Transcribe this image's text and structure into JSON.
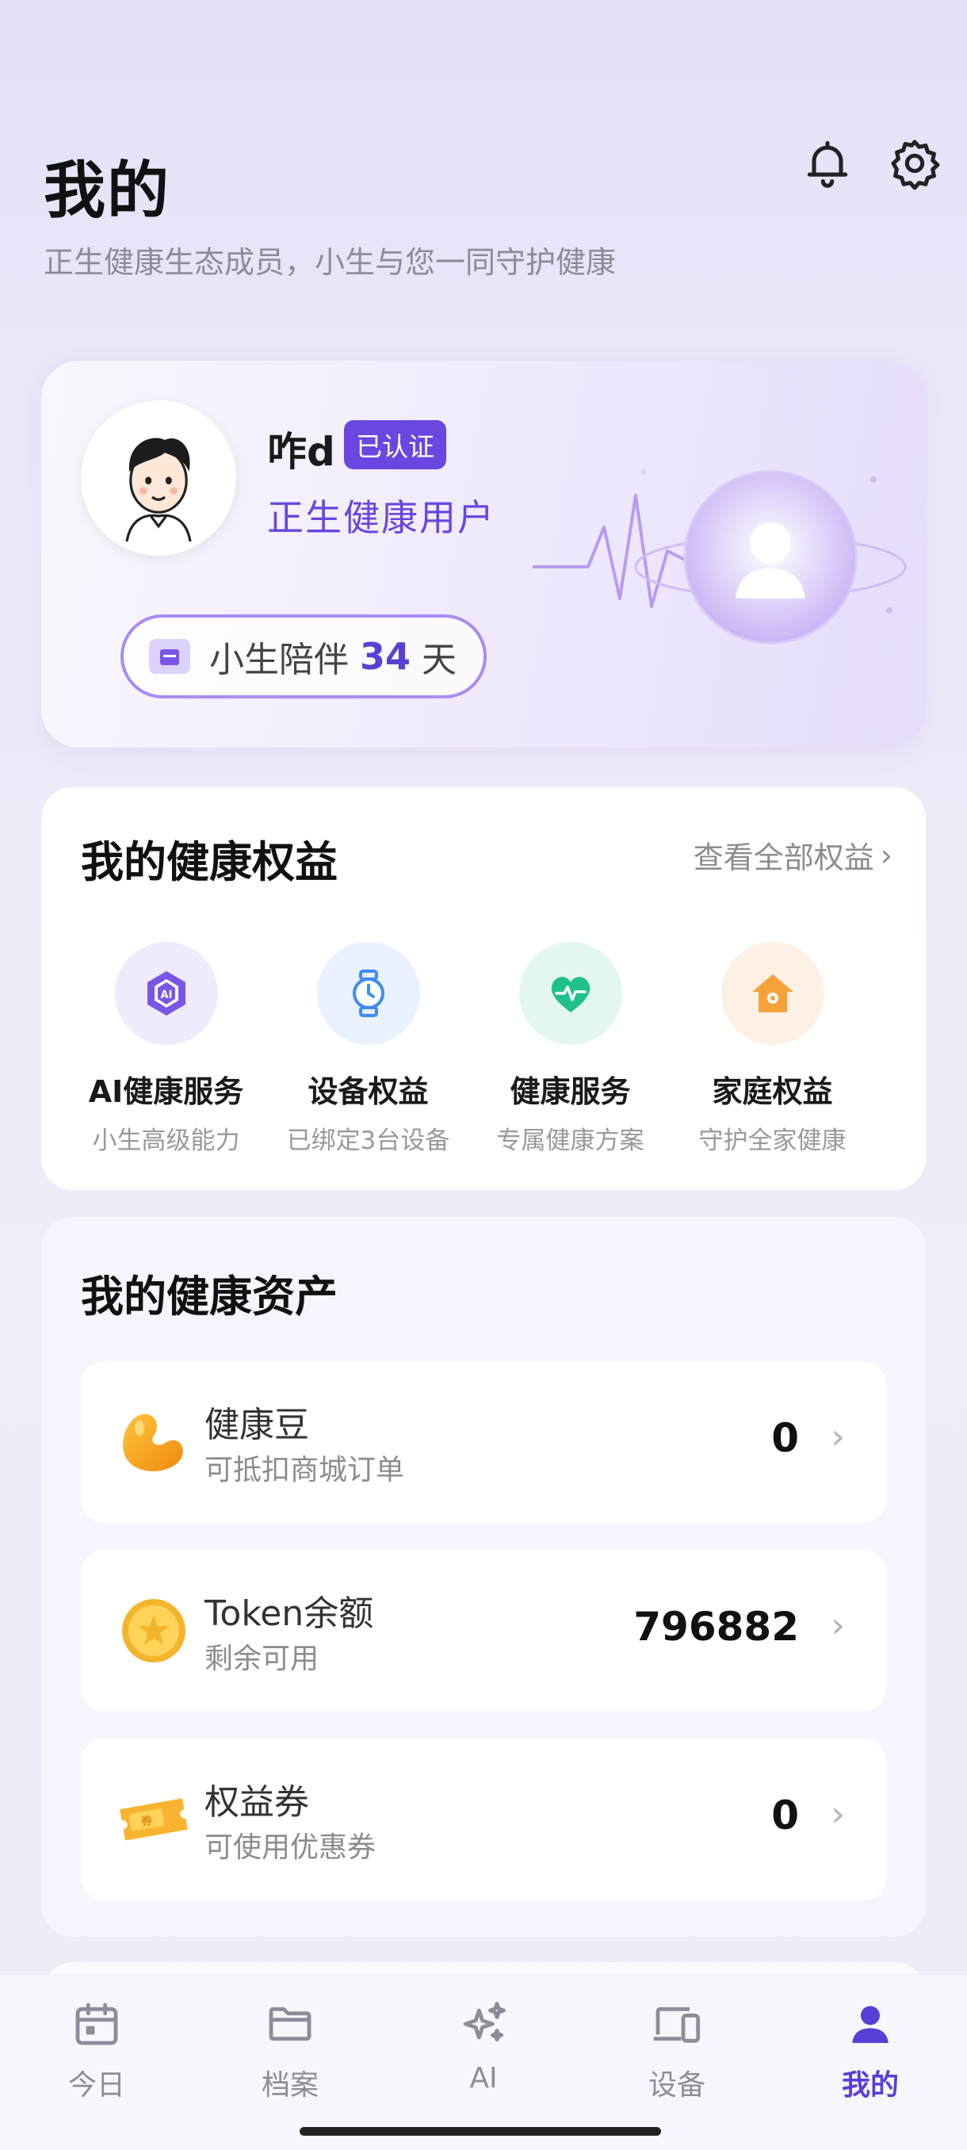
{
  "header": {
    "title": "我的",
    "subtitle": "正生健康生态成员，小生与您一同守护健康",
    "icons": [
      "bell-icon",
      "gear-icon"
    ]
  },
  "profile": {
    "name": "咋d",
    "badge": "已认证",
    "user_type": "正生健康用户",
    "companion_prefix": "小生陪伴",
    "companion_days": "34",
    "companion_unit": "天"
  },
  "benefits": {
    "title": "我的健康权益",
    "view_all": "查看全部权益",
    "items": [
      {
        "title": "AI健康服务",
        "desc": "小生高级能力",
        "icon": "ai-chip-icon",
        "color": "#7b55e8"
      },
      {
        "title": "设备权益",
        "desc": "已绑定3台设备",
        "icon": "watch-icon",
        "color": "#3d8cf0"
      },
      {
        "title": "健康服务",
        "desc": "专属健康方案",
        "icon": "heart-pulse-icon",
        "color": "#1fc08a"
      },
      {
        "title": "家庭权益",
        "desc": "守护全家健康",
        "icon": "home-icon",
        "color": "#f5a23a"
      }
    ]
  },
  "assets": {
    "title": "我的健康资产",
    "items": [
      {
        "name": "健康豆",
        "desc": "可抵扣商城订单",
        "value": "0",
        "icon": "bean-icon"
      },
      {
        "name": "Token余额",
        "desc": "剩余可用",
        "value": "796882",
        "icon": "coin-icon"
      },
      {
        "name": "权益券",
        "desc": "可使用优惠券",
        "value": "0",
        "icon": "coupon-icon"
      }
    ]
  },
  "nav": {
    "items": [
      {
        "label": "今日",
        "icon": "calendar-icon"
      },
      {
        "label": "档案",
        "icon": "folder-icon"
      },
      {
        "label": "AI",
        "icon": "sparkle-icon"
      },
      {
        "label": "设备",
        "icon": "devices-icon"
      },
      {
        "label": "我的",
        "icon": "person-icon"
      }
    ],
    "active": "我的"
  },
  "colors": {
    "accent": "#5a3fd6",
    "badge": "#6b46e0"
  }
}
